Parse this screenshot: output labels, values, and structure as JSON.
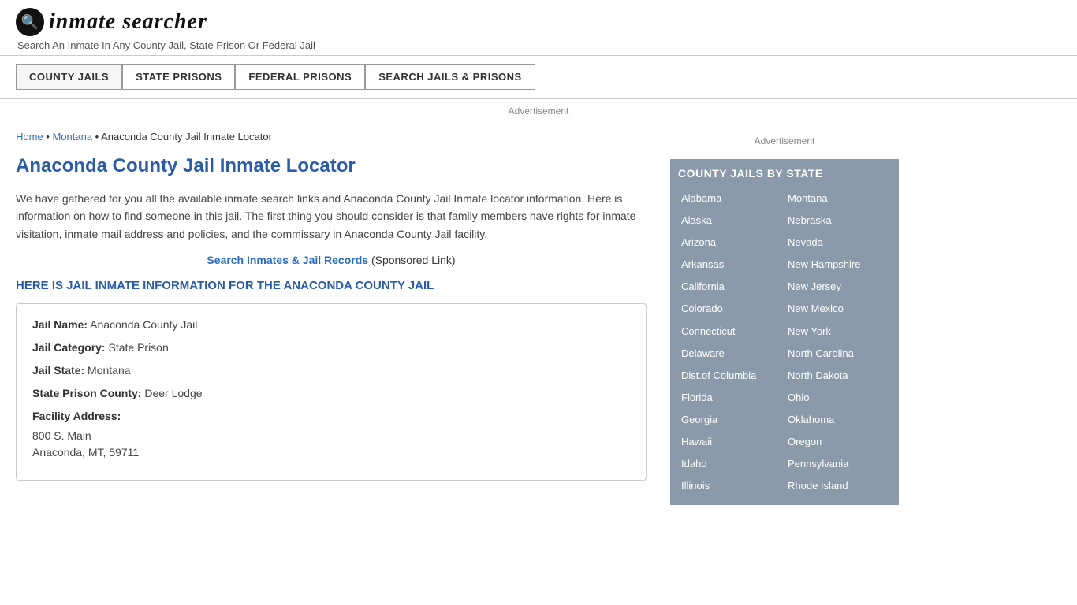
{
  "header": {
    "logo_text": "inmate searcher",
    "tagline": "Search An Inmate In Any County Jail, State Prison Or Federal Jail"
  },
  "nav": {
    "buttons": [
      {
        "label": "COUNTY JAILS",
        "active": true
      },
      {
        "label": "STATE PRISONS",
        "active": false
      },
      {
        "label": "FEDERAL PRISONS",
        "active": false
      },
      {
        "label": "SEARCH JAILS & PRISONS",
        "active": false
      }
    ]
  },
  "ad_top": "Advertisement",
  "breadcrumb": {
    "home": "Home",
    "separator1": " • ",
    "state": "Montana",
    "separator2": " • ",
    "current": "Anaconda County Jail Inmate Locator"
  },
  "page_title": "Anaconda County Jail Inmate Locator",
  "description": "We have gathered for you all the available inmate search links and Anaconda County Jail Inmate locator information. Here is information on how to find someone in this jail. The first thing you should consider is that family members have rights for inmate visitation, inmate mail address and policies, and the commissary in Anaconda County Jail facility.",
  "sponsored": {
    "link_text": "Search Inmates & Jail Records",
    "label": "(Sponsored Link)"
  },
  "section_heading": "HERE IS JAIL INMATE INFORMATION FOR THE ANACONDA COUNTY JAIL",
  "info_box": {
    "jail_name_label": "Jail Name:",
    "jail_name_value": "Anaconda County Jail",
    "category_label": "Jail Category:",
    "category_value": "State Prison",
    "state_label": "Jail State:",
    "state_value": "Montana",
    "county_label": "State Prison County:",
    "county_value": "Deer Lodge",
    "address_label": "Facility Address:",
    "address_line1": "800 S. Main",
    "address_line2": "Anaconda, MT, 59711"
  },
  "sidebar": {
    "ad_label": "Advertisement",
    "state_list_title": "COUNTY JAILS BY STATE",
    "states_left": [
      "Alabama",
      "Alaska",
      "Arizona",
      "Arkansas",
      "California",
      "Colorado",
      "Connecticut",
      "Delaware",
      "Dist.of Columbia",
      "Florida",
      "Georgia",
      "Hawaii",
      "Idaho",
      "Illinois"
    ],
    "states_right": [
      "Montana",
      "Nebraska",
      "Nevada",
      "New Hampshire",
      "New Jersey",
      "New Mexico",
      "New York",
      "North Carolina",
      "North Dakota",
      "Ohio",
      "Oklahoma",
      "Oregon",
      "Pennsylvania",
      "Rhode Island"
    ]
  }
}
